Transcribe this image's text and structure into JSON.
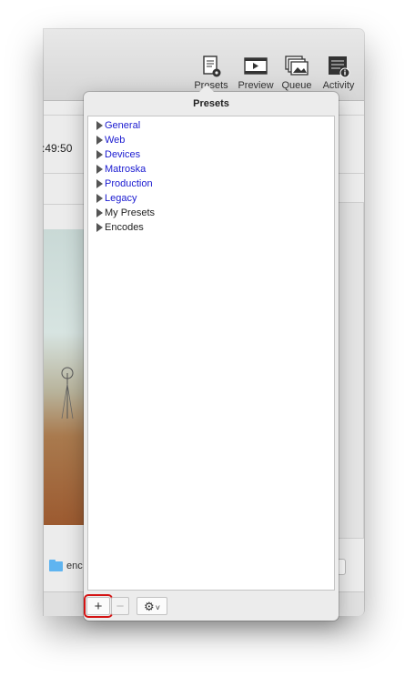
{
  "toolbar": {
    "items": [
      {
        "label": "Presets",
        "icon": "presets-icon"
      },
      {
        "label": "Preview",
        "icon": "preview-icon"
      },
      {
        "label": "Queue",
        "icon": "queue-icon"
      },
      {
        "label": "Activity",
        "icon": "activity-icon"
      }
    ]
  },
  "main": {
    "time_text": ":49:50",
    "destination_folder": "enc"
  },
  "popover": {
    "title": "Presets",
    "items": [
      {
        "label": "General",
        "color": "#1a1ad0"
      },
      {
        "label": "Web",
        "color": "#1a1ad0"
      },
      {
        "label": "Devices",
        "color": "#1a1ad0"
      },
      {
        "label": "Matroska",
        "color": "#1a1ad0"
      },
      {
        "label": "Production",
        "color": "#1a1ad0"
      },
      {
        "label": "Legacy",
        "color": "#1a1ad0"
      },
      {
        "label": "My Presets",
        "color": "#222222"
      },
      {
        "label": "Encodes",
        "color": "#222222"
      }
    ],
    "footer": {
      "add_label": "+",
      "remove_label": "−",
      "gear_label": "⚙",
      "chevron": "˅"
    },
    "highlight_color": "#d41313"
  }
}
